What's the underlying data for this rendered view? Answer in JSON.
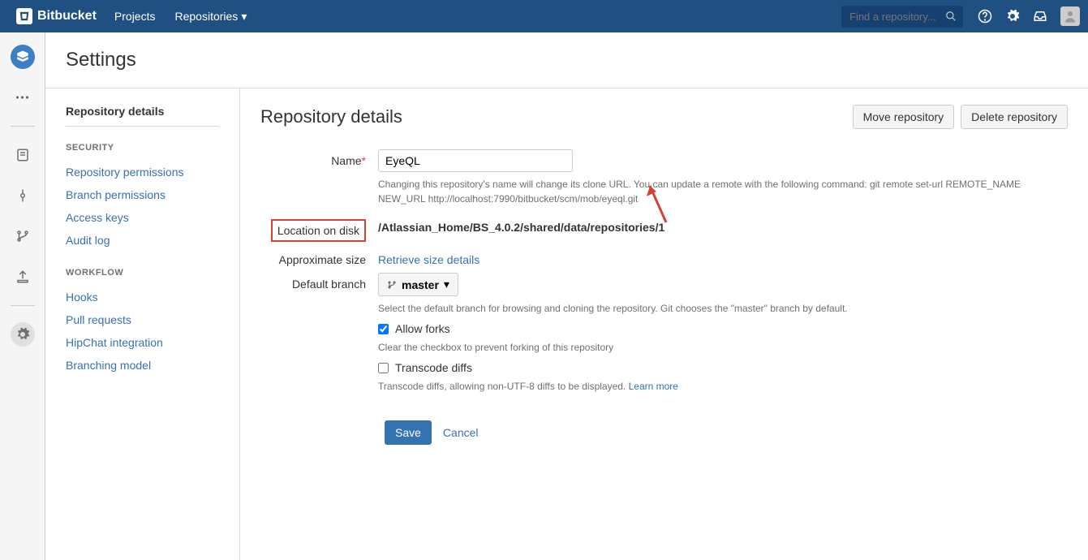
{
  "header": {
    "brand": "Bitbucket",
    "nav": {
      "projects": "Projects",
      "repositories": "Repositories"
    },
    "search_placeholder": "Find a repository..."
  },
  "page": {
    "title": "Settings"
  },
  "sidebar": {
    "current": "Repository details",
    "security_label": "SECURITY",
    "security_items": [
      "Repository permissions",
      "Branch permissions",
      "Access keys",
      "Audit log"
    ],
    "workflow_label": "WORKFLOW",
    "workflow_items": [
      "Hooks",
      "Pull requests",
      "HipChat integration",
      "Branching model"
    ]
  },
  "main": {
    "title": "Repository details",
    "move_btn": "Move repository",
    "delete_btn": "Delete repository",
    "form": {
      "name_label": "Name",
      "name_value": "EyeQL",
      "name_help": "Changing this repository's name will change its clone URL. You can update a remote with the following command: git remote set-url REMOTE_NAME NEW_URL http://localhost:7990/bitbucket/scm/mob/eyeql.git",
      "location_label": "Location on disk",
      "location_value": "/Atlassian_Home/BS_4.0.2/shared/data/repositories/1",
      "size_label": "Approximate size",
      "size_action": "Retrieve size details",
      "branch_label": "Default branch",
      "branch_value": "master",
      "branch_help": "Select the default branch for browsing and cloning the repository. Git chooses the \"master\" branch by default.",
      "allow_forks_label": "Allow forks",
      "allow_forks_checked": true,
      "allow_forks_help": "Clear the checkbox to prevent forking of this repository",
      "transcode_label": "Transcode diffs",
      "transcode_checked": false,
      "transcode_help": "Transcode diffs, allowing non-UTF-8 diffs to be displayed. ",
      "learn_more": "Learn more",
      "save": "Save",
      "cancel": "Cancel"
    }
  }
}
